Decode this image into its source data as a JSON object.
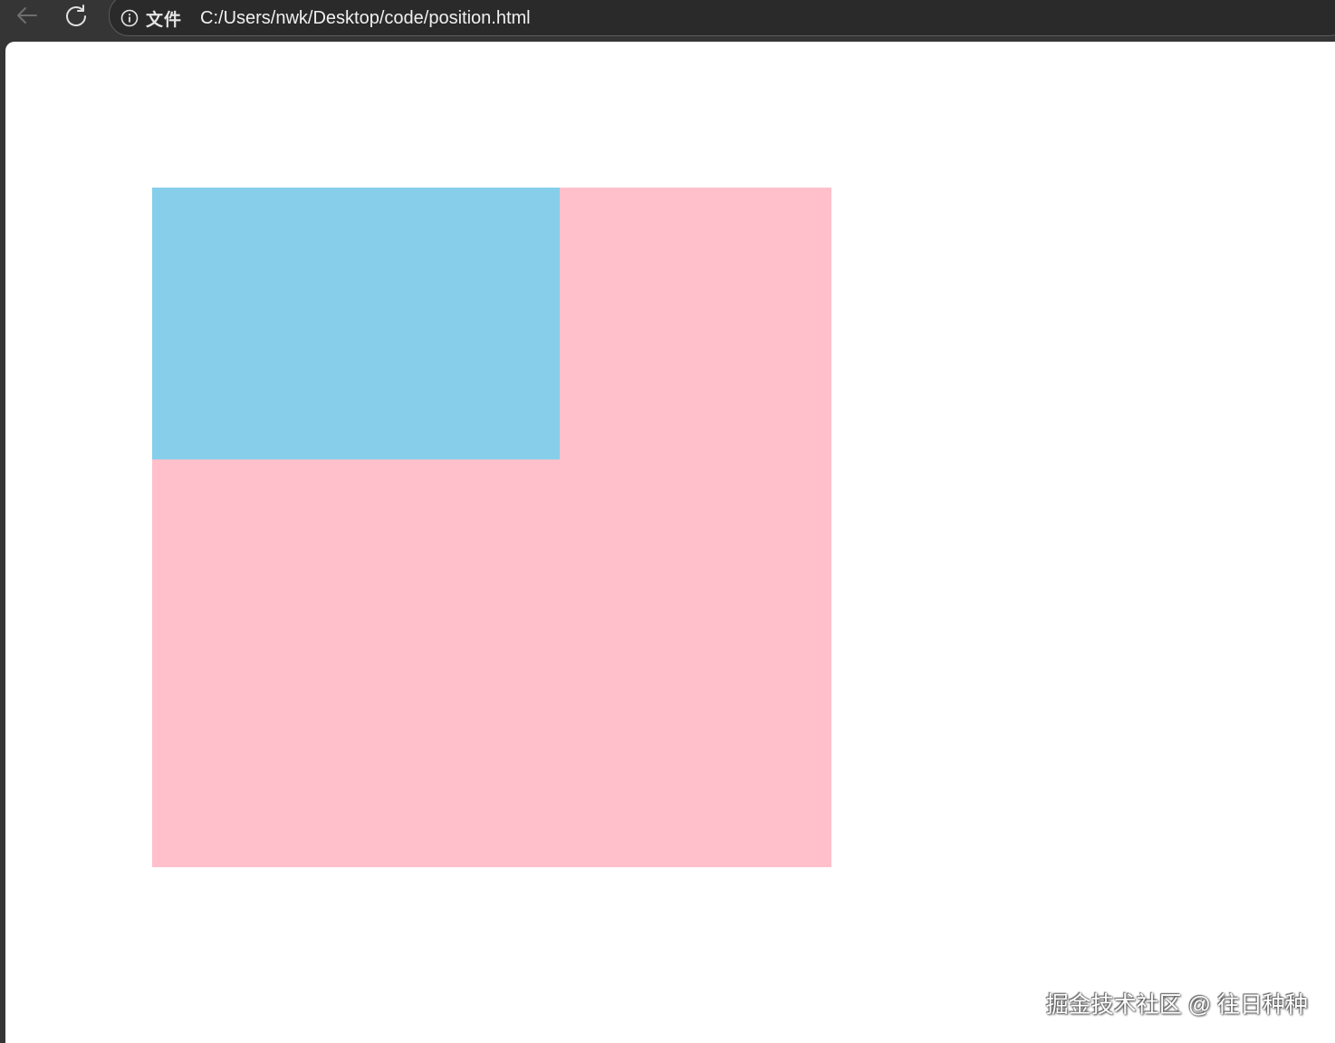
{
  "browser": {
    "back_icon": "arrow-left-icon",
    "reload_icon": "reload-icon",
    "info_icon": "info-icon",
    "scheme_label": "文件",
    "url": "C:/Users/nwk/Desktop/code/position.html"
  },
  "page": {
    "outer_box_color": "#ffc0cb",
    "inner_box_color": "#87ceeb"
  },
  "watermark": {
    "text": "掘金技术社区 @ 往日种种"
  },
  "colors": {
    "toolbar_bg": "#353535",
    "page_bg": "#ffffff"
  }
}
